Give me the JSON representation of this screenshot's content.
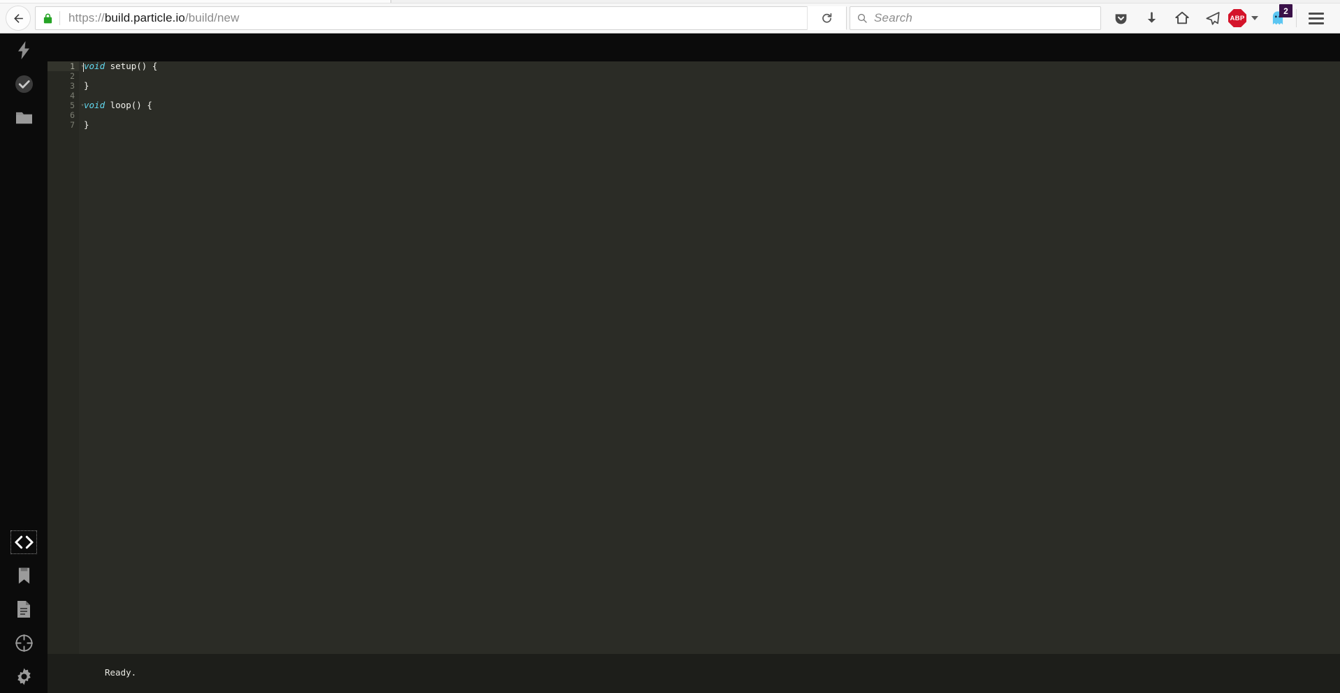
{
  "browser": {
    "back_label": "Back",
    "lock_icon": "padlock-secure-icon",
    "url_prefix": "https://",
    "url_host_sub": "build.",
    "url_host_strong": "particle.io",
    "url_path": "/build/new",
    "url_full": "https://build.particle.io/build/new",
    "reload_label": "Reload",
    "search": {
      "placeholder": "Search",
      "value": ""
    },
    "toolbar_buttons": [
      {
        "name": "pocket-icon",
        "label": "Save to Pocket"
      },
      {
        "name": "download-icon",
        "label": "Downloads"
      },
      {
        "name": "home-icon",
        "label": "Home"
      },
      {
        "name": "paper-plane-icon",
        "label": "Send"
      }
    ],
    "adblock": {
      "label": "ABP",
      "has_dropdown": true
    },
    "ghostery": {
      "name": "ghost-icon",
      "badge": "2"
    },
    "menu_label": "Open menu"
  },
  "sidebar": {
    "top_items": [
      {
        "name": "flash-icon",
        "label": "Flash"
      },
      {
        "name": "verify-check-icon",
        "label": "Verify"
      },
      {
        "name": "folder-icon",
        "label": "Open app"
      }
    ],
    "bottom_items": [
      {
        "name": "code-brackets-icon",
        "label": "Code",
        "active": true
      },
      {
        "name": "bookmark-icon",
        "label": "Libraries",
        "active": false
      },
      {
        "name": "document-icon",
        "label": "Docs",
        "active": false
      },
      {
        "name": "target-icon",
        "label": "Devices",
        "active": false
      },
      {
        "name": "gear-icon",
        "label": "Settings",
        "active": false
      }
    ]
  },
  "editor": {
    "line_numbers": [
      "1",
      "2",
      "3",
      "4",
      "5",
      "6",
      "7"
    ],
    "fold_lines": [
      1,
      5
    ],
    "active_line": 1,
    "lines": [
      {
        "n": 1,
        "tokens": [
          {
            "t": "void",
            "k": "kw"
          },
          {
            "t": " setup() {",
            "k": ""
          }
        ]
      },
      {
        "n": 2,
        "tokens": [
          {
            "t": "",
            "k": ""
          }
        ]
      },
      {
        "n": 3,
        "tokens": [
          {
            "t": "}",
            "k": ""
          }
        ]
      },
      {
        "n": 4,
        "tokens": [
          {
            "t": "",
            "k": ""
          }
        ]
      },
      {
        "n": 5,
        "tokens": [
          {
            "t": "void",
            "k": "kw"
          },
          {
            "t": " loop() {",
            "k": ""
          }
        ]
      },
      {
        "n": 6,
        "tokens": [
          {
            "t": "",
            "k": ""
          }
        ]
      },
      {
        "n": 7,
        "tokens": [
          {
            "t": "}",
            "k": ""
          }
        ]
      }
    ],
    "fold_glyph": "▾"
  },
  "status": {
    "text": "Ready."
  },
  "colors": {
    "chrome_bg": "#f7f7f7",
    "sidebar_bg": "#0b0b0b",
    "editor_bg": "#2b2c26",
    "gutter_bg": "#272822",
    "statusbar_bg": "#1d1e1a",
    "keyword": "#62d8ef",
    "code_text": "#f3f3ee",
    "abp_red": "#d4142a",
    "ghostery_badge": "#3a1048",
    "lock_green": "#25a325"
  }
}
